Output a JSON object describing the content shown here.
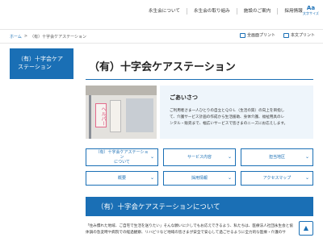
{
  "header": {
    "nav": [
      {
        "label": "永生会について"
      },
      {
        "label": "永生会の取り組み"
      },
      {
        "label": "施設のご案内"
      },
      {
        "label": "採用情報"
      }
    ],
    "font_size": {
      "icon": "Aa",
      "label": "文字サイズ"
    }
  },
  "breadcrumb": {
    "home": "ホーム",
    "separator": ">",
    "current": "（有）十字会ケアステーション"
  },
  "print": {
    "full": "全画面プリント",
    "body": "本文プリント"
  },
  "side_title": "（有）十字会ケアステーション",
  "page_title": "（有）十字会ケアステーション",
  "photo": {
    "sign_text": "ヘルパー"
  },
  "greeting": {
    "title": "ごあいさつ",
    "lines": [
      "ご利用者さま一人ひとりの自立とＱＯＬ（生活の質）の向上を目指し",
      "て、介護サービス計画の作成から生活援助、身体介護、福祉用具のレ",
      "ンタル・販売まで、幅広いサービスで皆さまのニーズにお応えします。"
    ]
  },
  "links": [
    {
      "label": "（有）十字会ケアステーション\nについて",
      "tall": true
    },
    {
      "label": "サービス内容"
    },
    {
      "label": "担当地区"
    },
    {
      "label": "概要"
    },
    {
      "label": "採用情報"
    },
    {
      "label": "アクセスマップ"
    }
  ],
  "section": {
    "title": "（有）十字会ケアステーションについて",
    "lines": [
      "「住み慣れた地域、ご自宅で生活を送りたい」そんな願いに少しでもお応えできるよう、私たちは、医療法人社団永生会と協",
      "体調の急変時や病院での経過観察、リハビリなど地域の皆さまが安全で安心して過ごせるように全力的な医療・介護のサ"
    ]
  },
  "top_button": {
    "icon": "▲"
  },
  "colors": {
    "accent": "#1a6fb5",
    "card_bg": "#eef5fb"
  }
}
